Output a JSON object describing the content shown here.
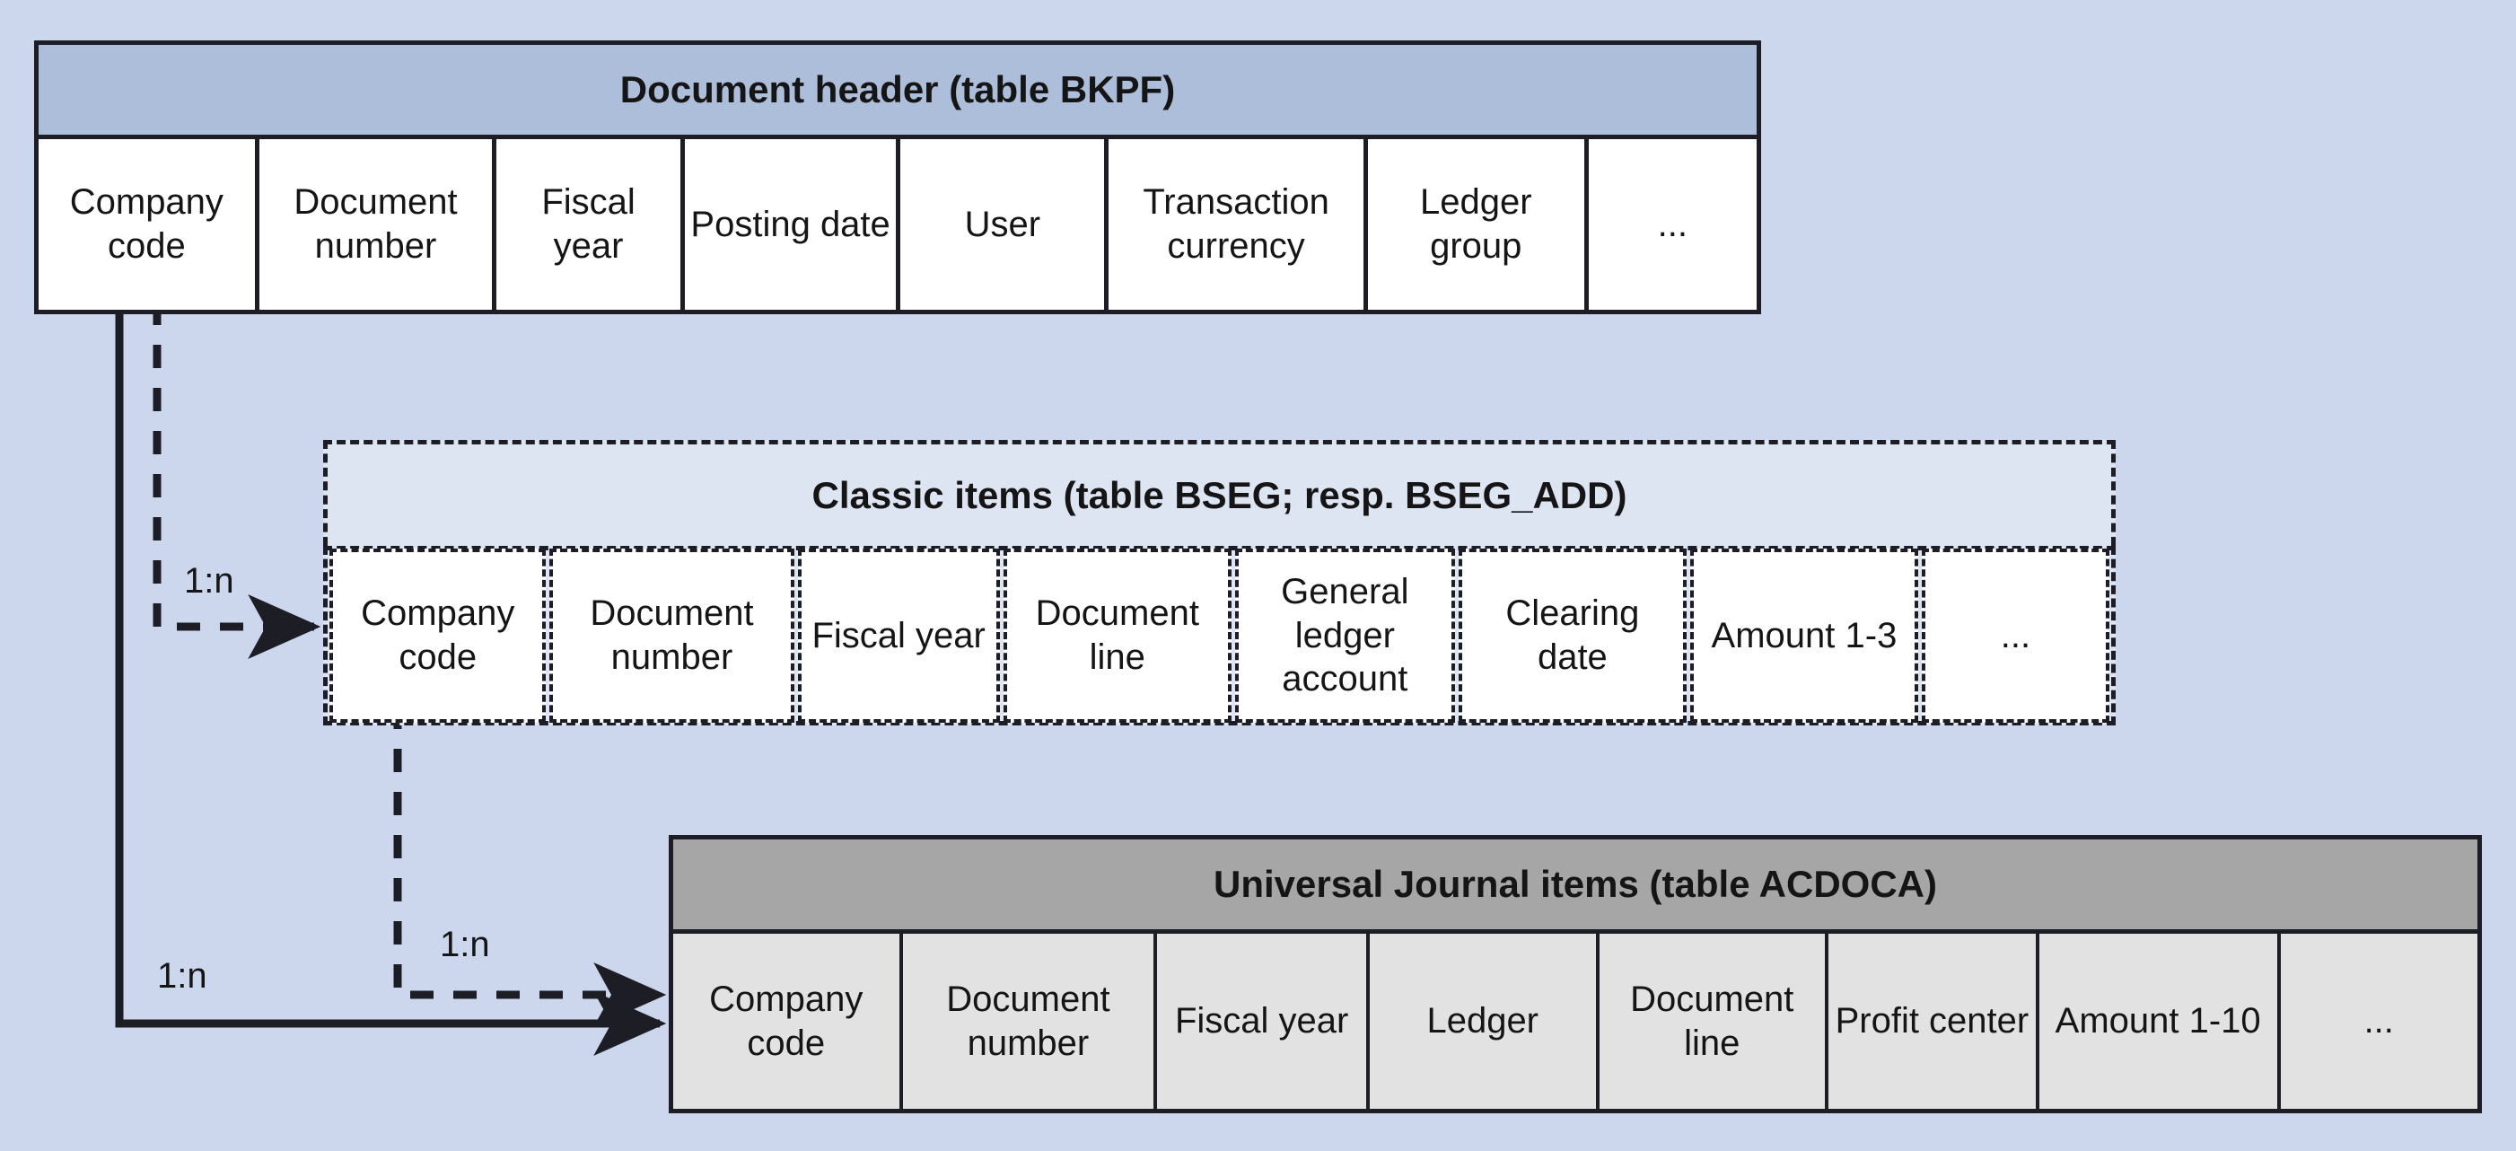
{
  "diagram": {
    "type": "entity-relationship",
    "background_color": "#ccd7ee",
    "tables": [
      {
        "id": "bkpf",
        "title": "Document header (table BKPF)",
        "style": "solid",
        "header_color": "#adbedb",
        "cell_color": "#ffffff",
        "columns": [
          "Company code",
          "Document number",
          "Fiscal year",
          "Posting date",
          "User",
          "Transaction currency",
          "Ledger group",
          "..."
        ]
      },
      {
        "id": "bseg",
        "title": "Classic items (table BSEG; resp. BSEG_ADD)",
        "style": "dashed",
        "header_color": "#dde5f2",
        "cell_color": "#ffffff",
        "columns": [
          "Company code",
          "Document number",
          "Fiscal year",
          "Document line",
          "General ledger account",
          "Clearing date",
          "Amount 1-3",
          "..."
        ]
      },
      {
        "id": "acdoca",
        "title": "Universal Journal items (table ACDOCA)",
        "style": "solid",
        "header_color": "#a6a6a6",
        "cell_color": "#e2e2e2",
        "columns": [
          "Company code",
          "Document number",
          "Fiscal year",
          "Ledger",
          "Document line",
          "Profit center",
          "Amount 1-10",
          "..."
        ]
      }
    ],
    "relations": [
      {
        "id": "bkpf-to-bseg",
        "label": "1:n",
        "style": "dashed",
        "from": "bkpf",
        "to": "bseg"
      },
      {
        "id": "bseg-to-acdoca",
        "label": "1:n",
        "style": "dashed",
        "from": "bseg",
        "to": "acdoca"
      },
      {
        "id": "bkpf-to-acdoca",
        "label": "1:n",
        "style": "solid",
        "from": "bkpf",
        "to": "acdoca"
      }
    ]
  }
}
